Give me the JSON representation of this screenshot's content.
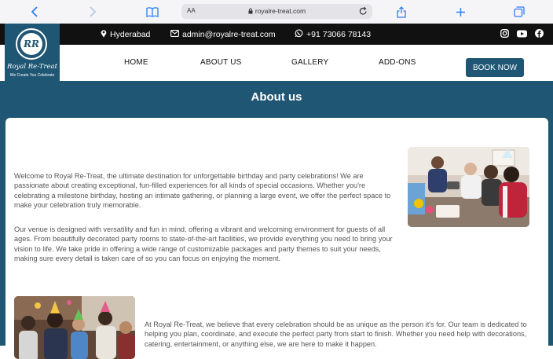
{
  "browser": {
    "aa_label": "AA",
    "url": "royalre-treat.com",
    "icons": {
      "back": "chevron-left-icon",
      "forward": "chevron-right-icon",
      "reader": "book-icon",
      "reload": "reload-icon",
      "share": "share-icon",
      "new_tab": "plus-icon",
      "tabs": "tabs-icon"
    }
  },
  "topbar": {
    "location": "Hyderabad",
    "email": "admin@royalre-treat.com",
    "phone": "+91 73066 78143",
    "social": [
      "instagram-icon",
      "youtube-icon",
      "facebook-icon"
    ]
  },
  "logo": {
    "monogram": "RR",
    "brand": "Royal Re-Treat",
    "tagline": "We Create You Celebrate"
  },
  "nav": {
    "items": [
      "HOME",
      "ABOUT US",
      "GALLERY",
      "ADD-ONS"
    ],
    "cta": "BOOK NOW"
  },
  "section": {
    "title": "About us"
  },
  "content": {
    "p1": "Welcome to Royal Re-Treat, the ultimate destination for unforgettable birthday and party celebrations! We are passionate about creating exceptional, fun-filled experiences for all kinds of special occasions. Whether you're celebrating a milestone birthday, hosting an intimate gathering, or planning a large event, we offer the perfect space to make your celebration truly memorable.",
    "p2": "Our venue is designed with versatility and fun in mind, offering a vibrant and welcoming environment for guests of all ages. From beautifully decorated party rooms to state-of-the-art facilities, we provide everything you need to bring your vision to life. We take pride in offering a wide range of customizable packages and party themes to suit your needs, making sure every detail is taken care of so you can focus on enjoying the moment.",
    "p3": "At Royal Re-Treat, we believe that every celebration should be as unique as the person it's for. Our team is dedicated to helping you plan, coordinate, and execute the perfect party from start to finish. Whether you need help with decorations, catering, entertainment, or anything else, we are here to make it happen."
  },
  "colors": {
    "brand": "#1f5673",
    "topbar": "#111111",
    "browser_accent": "#2f7cf6"
  }
}
